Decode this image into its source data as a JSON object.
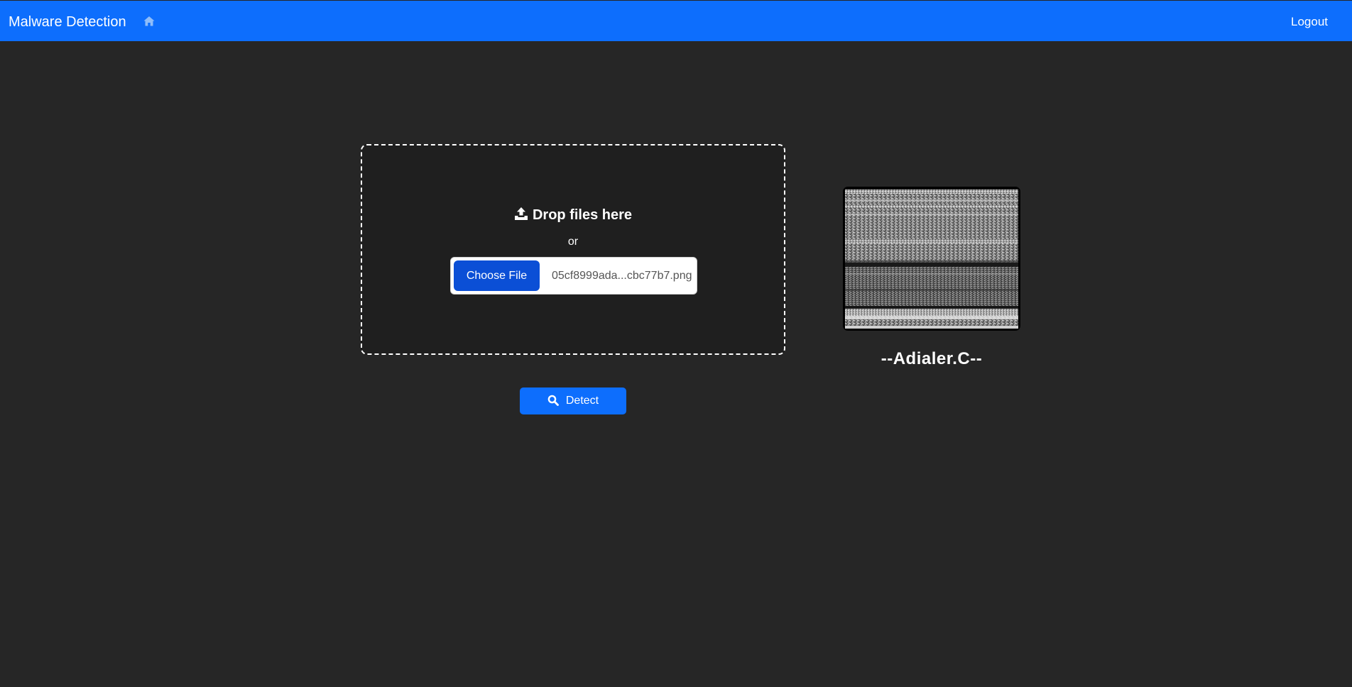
{
  "navbar": {
    "brand": "Malware Detection",
    "home_icon": "home-icon",
    "logout_label": "Logout",
    "background": "#0d6efd"
  },
  "upload": {
    "icon": "upload-icon",
    "title": "Drop files here",
    "or_text": "or",
    "choose_label": "Choose File",
    "file_name": "05cf8999ada...cbc77b7.png"
  },
  "detect": {
    "icon": "search-icon",
    "label": "Detect"
  },
  "result": {
    "image_description": "malware-grayscale-visualization",
    "label": "--Adialer.C--"
  },
  "colors": {
    "page_background": "#262626",
    "dropzone_background": "#1f1f1f",
    "primary": "#0d6efd",
    "choose_button": "#0b4fd6"
  }
}
